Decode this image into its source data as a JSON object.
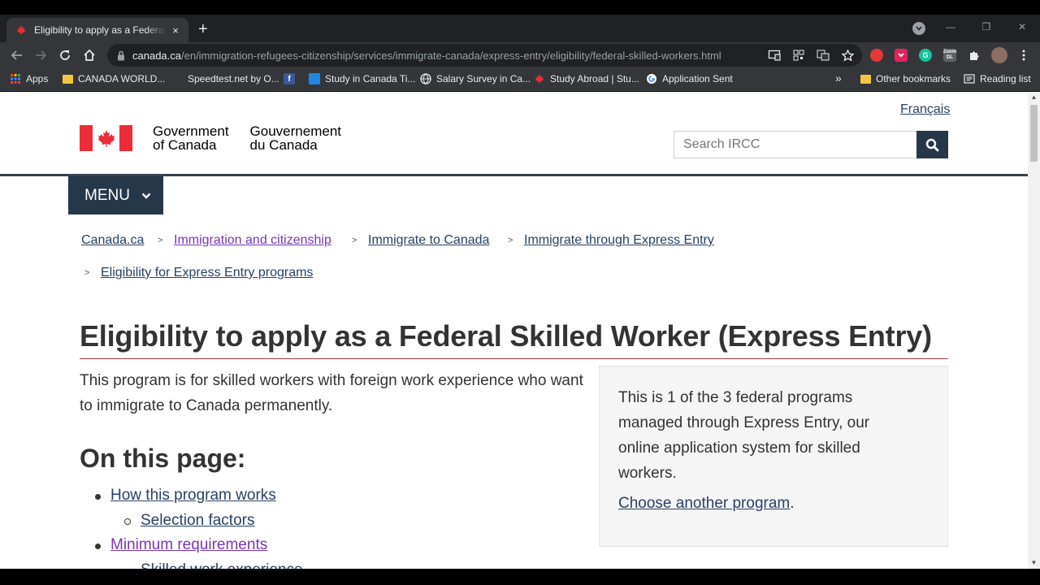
{
  "browser": {
    "tab_title": "Eligibility to apply as a Federal Skilled Worker (Express Entry)",
    "tab_close": "×",
    "new_tab": "+",
    "url_host": "canada.ca",
    "url_path": "/en/immigration-refugees-citizenship/services/immigrate-canada/express-entry/eligibility/federal-skilled-workers.html",
    "window_controls": [
      "—",
      "❐",
      "✕"
    ],
    "bookmarks": [
      {
        "label": "Apps",
        "icon": "apps-grid-icon"
      },
      {
        "label": "CANADA WORLD...",
        "icon": "folder-icon"
      },
      {
        "label": "Speedtest.net by O...",
        "icon": "speedtest-icon"
      },
      {
        "label": "",
        "icon": "facebook-icon"
      },
      {
        "label": "Study in Canada Ti...",
        "icon": "bookmark-favicon-icon"
      },
      {
        "label": "Salary Survey in Ca...",
        "icon": "globe-icon"
      },
      {
        "label": "Study Abroad | Stu...",
        "icon": "maple-leaf-icon"
      },
      {
        "label": "Application Sent",
        "icon": "google-icon"
      }
    ],
    "overflow": "»",
    "other_bookmarks": "Other bookmarks",
    "reading_list": "Reading list",
    "ext_zoom_label": "Zoom DL"
  },
  "header": {
    "language_link": "Français",
    "gov_en_line1": "Government",
    "gov_en_line2": "of Canada",
    "gov_fr_line1": "Gouvernement",
    "gov_fr_line2": "du Canada",
    "search_placeholder": "Search IRCC",
    "menu_label": "MENU"
  },
  "breadcrumbs": [
    {
      "label": "Canada.ca",
      "visited": false
    },
    {
      "label": "Immigration and citizenship",
      "visited": true
    },
    {
      "label": "Immigrate to Canada",
      "visited": false
    },
    {
      "label": "Immigrate through Express Entry",
      "visited": false
    },
    {
      "label": "Eligibility for Express Entry programs",
      "visited": false
    }
  ],
  "breadcrumb_separator": ">",
  "main": {
    "title": "Eligibility to apply as a Federal Skilled Worker (Express Entry)",
    "intro": "This program is for skilled workers with foreign work experience who want to immigrate to Canada permanently.",
    "on_this_page": "On this page:",
    "toc": [
      {
        "label": "How this program works",
        "level": 1,
        "visited": false
      },
      {
        "label": "Selection factors",
        "level": 2,
        "visited": false
      },
      {
        "label": "Minimum requirements",
        "level": 1,
        "visited": true
      },
      {
        "label": "Skilled work experience",
        "level": 2,
        "visited": false
      }
    ]
  },
  "panel": {
    "text": "This is 1 of the 3 federal programs managed through Express Entry, our online application system for skilled workers.",
    "link_label": "Choose another program",
    "link_suffix": "."
  },
  "colors": {
    "link": "#284162",
    "visited": "#7834bc",
    "gc_navy": "#26374a",
    "flag_red": "#eb2d37",
    "title_rule": "#af3c43"
  }
}
